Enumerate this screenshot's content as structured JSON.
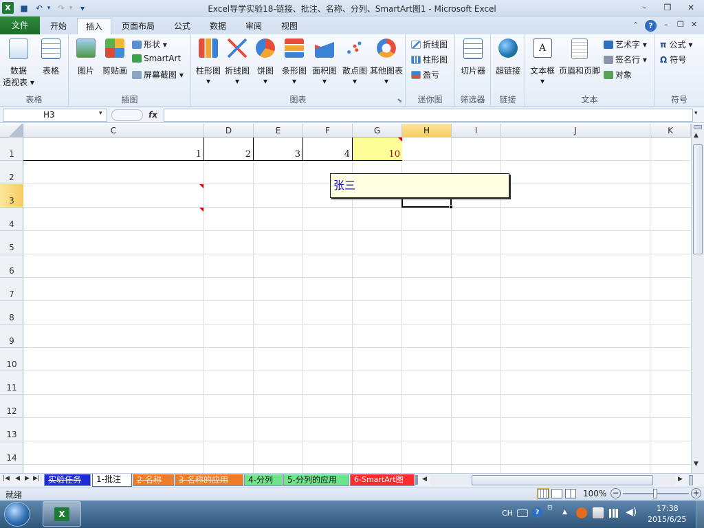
{
  "window": {
    "title": "Excel导学实验18-链接、批注、名称、分列、SmartArt图1  -  Microsoft Excel",
    "qat_more": "▾"
  },
  "ribbon_tabs": [
    "文件",
    "开始",
    "插入",
    "页面布局",
    "公式",
    "数据",
    "审阅",
    "视图"
  ],
  "ribbon": {
    "tables": {
      "btn1": "数据",
      "btn1b": "透视表 ▾",
      "btn2": "表格",
      "label": "表格"
    },
    "illustrations": {
      "pic": "图片",
      "clip": "剪贴画",
      "shapes": "形状 ▾",
      "smartart": "SmartArt",
      "screenshot": "屏幕截图 ▾",
      "label": "插图"
    },
    "charts": {
      "items": [
        "柱形图",
        "折线图",
        "饼图",
        "条形图",
        "面积图",
        "散点图",
        "其他图表"
      ],
      "label": "图表"
    },
    "sparklines": {
      "items": [
        "折线图",
        "柱形图",
        "盈亏"
      ],
      "label": "迷你图"
    },
    "filter": {
      "btn": "切片器",
      "label": "筛选器"
    },
    "links": {
      "btn": "超链接",
      "label": "链接"
    },
    "text": {
      "textbox": "文本框",
      "header": "页眉和页脚",
      "wordart": "艺术字 ▾",
      "sigline": "签名行 ▾",
      "object": "对象",
      "label": "文本"
    },
    "symbols": {
      "equation": "公式 ▾",
      "symbol": "符号",
      "label": "符号"
    }
  },
  "formula_bar": {
    "name_box": "H3",
    "fx": "fx",
    "formula": ""
  },
  "columns": [
    "C",
    "D",
    "E",
    "F",
    "G",
    "H",
    "I",
    "J",
    "K"
  ],
  "rows": [
    "1",
    "2",
    "3",
    "4",
    "5",
    "6",
    "7",
    "8",
    "9",
    "10",
    "11",
    "12",
    "13",
    "14"
  ],
  "cells": {
    "C1": "1",
    "D1": "2",
    "E1": "3",
    "F1": "4",
    "G1": "10"
  },
  "comment": {
    "text": "张三"
  },
  "sheet_tabs": [
    "实验任务",
    "1-批注",
    "2-名称",
    "3-名称的应用",
    "4-分列",
    "5-分列的应用",
    "6-SmartArt图"
  ],
  "status": {
    "ready": "就绪",
    "zoom": "100%"
  },
  "taskbar": {
    "lang": "CH",
    "time": "17:38",
    "date": "2015/6/25"
  },
  "colors": {
    "accent_file": "#1d6b2b",
    "selected_header": "#f5cb60",
    "comment_bg": "#ffffe1",
    "red_value": "#c00000"
  }
}
